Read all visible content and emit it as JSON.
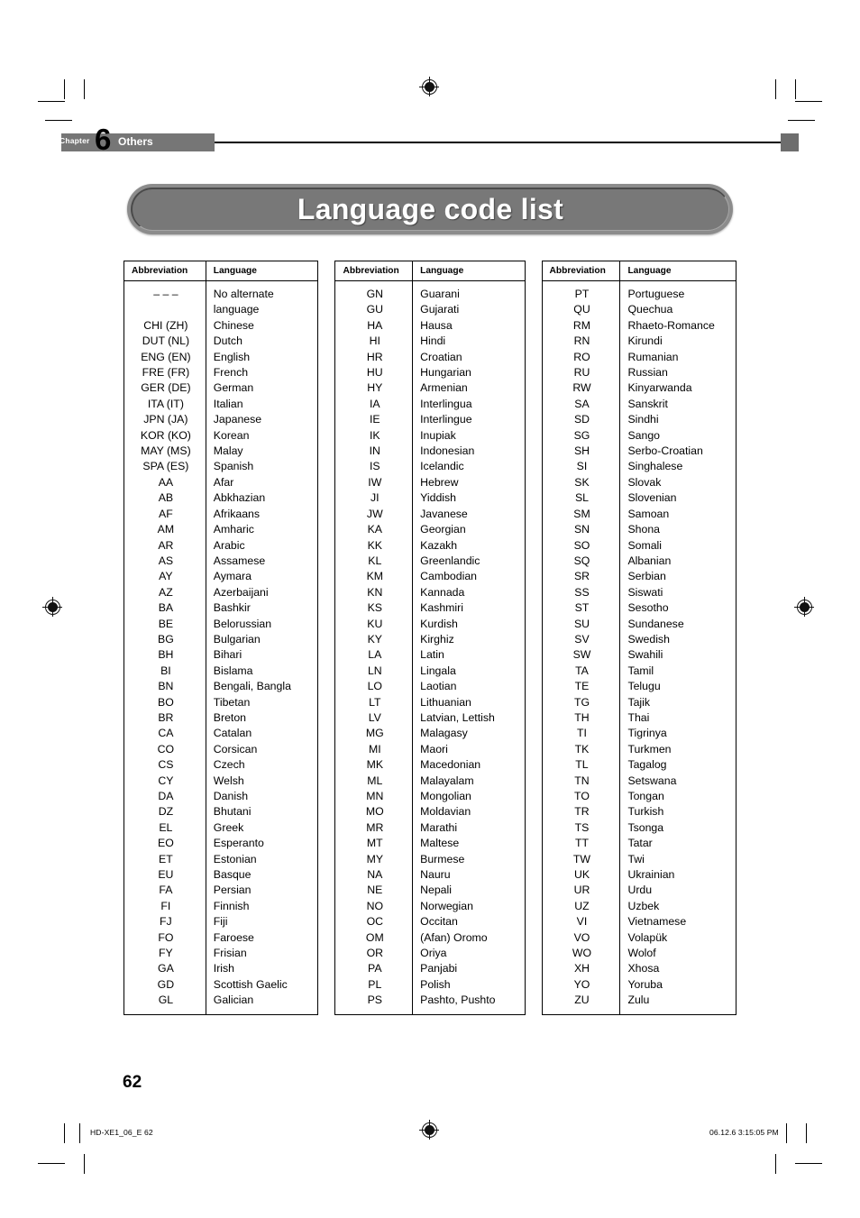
{
  "header": {
    "chapter_word": "Chapter",
    "chapter_number": "6",
    "chapter_title": "Others"
  },
  "title": "Language code list",
  "table_headers": {
    "abbreviation": "Abbreviation",
    "language": "Language"
  },
  "columns": [
    {
      "rows": [
        {
          "abbr": "– – –",
          "lang": "No alternate"
        },
        {
          "abbr": "",
          "lang": "language"
        },
        {
          "abbr": "CHI (ZH)",
          "lang": "Chinese"
        },
        {
          "abbr": "DUT (NL)",
          "lang": "Dutch"
        },
        {
          "abbr": "ENG (EN)",
          "lang": "English"
        },
        {
          "abbr": "FRE (FR)",
          "lang": "French"
        },
        {
          "abbr": "GER (DE)",
          "lang": "German"
        },
        {
          "abbr": "ITA (IT)",
          "lang": "Italian"
        },
        {
          "abbr": "JPN (JA)",
          "lang": "Japanese"
        },
        {
          "abbr": "KOR (KO)",
          "lang": "Korean"
        },
        {
          "abbr": "MAY (MS)",
          "lang": "Malay"
        },
        {
          "abbr": "SPA (ES)",
          "lang": "Spanish"
        },
        {
          "abbr": "AA",
          "lang": "Afar"
        },
        {
          "abbr": "AB",
          "lang": "Abkhazian"
        },
        {
          "abbr": "AF",
          "lang": "Afrikaans"
        },
        {
          "abbr": "AM",
          "lang": "Amharic"
        },
        {
          "abbr": "AR",
          "lang": "Arabic"
        },
        {
          "abbr": "AS",
          "lang": "Assamese"
        },
        {
          "abbr": "AY",
          "lang": "Aymara"
        },
        {
          "abbr": "AZ",
          "lang": "Azerbaijani"
        },
        {
          "abbr": "BA",
          "lang": "Bashkir"
        },
        {
          "abbr": "BE",
          "lang": "Belorussian"
        },
        {
          "abbr": "BG",
          "lang": "Bulgarian"
        },
        {
          "abbr": "BH",
          "lang": "Bihari"
        },
        {
          "abbr": "BI",
          "lang": "Bislama"
        },
        {
          "abbr": "BN",
          "lang": "Bengali, Bangla"
        },
        {
          "abbr": "BO",
          "lang": "Tibetan"
        },
        {
          "abbr": "BR",
          "lang": "Breton"
        },
        {
          "abbr": "CA",
          "lang": "Catalan"
        },
        {
          "abbr": "CO",
          "lang": "Corsican"
        },
        {
          "abbr": "CS",
          "lang": "Czech"
        },
        {
          "abbr": "CY",
          "lang": "Welsh"
        },
        {
          "abbr": "DA",
          "lang": "Danish"
        },
        {
          "abbr": "DZ",
          "lang": "Bhutani"
        },
        {
          "abbr": "EL",
          "lang": "Greek"
        },
        {
          "abbr": "EO",
          "lang": "Esperanto"
        },
        {
          "abbr": "ET",
          "lang": "Estonian"
        },
        {
          "abbr": "EU",
          "lang": "Basque"
        },
        {
          "abbr": "FA",
          "lang": "Persian"
        },
        {
          "abbr": "FI",
          "lang": "Finnish"
        },
        {
          "abbr": "FJ",
          "lang": "Fiji"
        },
        {
          "abbr": "FO",
          "lang": "Faroese"
        },
        {
          "abbr": "FY",
          "lang": "Frisian"
        },
        {
          "abbr": "GA",
          "lang": "Irish"
        },
        {
          "abbr": "GD",
          "lang": "Scottish Gaelic"
        },
        {
          "abbr": "GL",
          "lang": "Galician"
        }
      ]
    },
    {
      "rows": [
        {
          "abbr": "GN",
          "lang": "Guarani"
        },
        {
          "abbr": "GU",
          "lang": "Gujarati"
        },
        {
          "abbr": "HA",
          "lang": "Hausa"
        },
        {
          "abbr": "HI",
          "lang": "Hindi"
        },
        {
          "abbr": "HR",
          "lang": "Croatian"
        },
        {
          "abbr": "HU",
          "lang": "Hungarian"
        },
        {
          "abbr": "HY",
          "lang": "Armenian"
        },
        {
          "abbr": "IA",
          "lang": "Interlingua"
        },
        {
          "abbr": "IE",
          "lang": "Interlingue"
        },
        {
          "abbr": "IK",
          "lang": "Inupiak"
        },
        {
          "abbr": "IN",
          "lang": "Indonesian"
        },
        {
          "abbr": "IS",
          "lang": "Icelandic"
        },
        {
          "abbr": "IW",
          "lang": "Hebrew"
        },
        {
          "abbr": "JI",
          "lang": "Yiddish"
        },
        {
          "abbr": "JW",
          "lang": "Javanese"
        },
        {
          "abbr": "KA",
          "lang": "Georgian"
        },
        {
          "abbr": "KK",
          "lang": "Kazakh"
        },
        {
          "abbr": "KL",
          "lang": "Greenlandic"
        },
        {
          "abbr": "KM",
          "lang": "Cambodian"
        },
        {
          "abbr": "KN",
          "lang": "Kannada"
        },
        {
          "abbr": "KS",
          "lang": "Kashmiri"
        },
        {
          "abbr": "KU",
          "lang": "Kurdish"
        },
        {
          "abbr": "KY",
          "lang": "Kirghiz"
        },
        {
          "abbr": "LA",
          "lang": "Latin"
        },
        {
          "abbr": "LN",
          "lang": "Lingala"
        },
        {
          "abbr": "LO",
          "lang": "Laotian"
        },
        {
          "abbr": "LT",
          "lang": "Lithuanian"
        },
        {
          "abbr": "LV",
          "lang": "Latvian, Lettish"
        },
        {
          "abbr": "MG",
          "lang": "Malagasy"
        },
        {
          "abbr": "MI",
          "lang": "Maori"
        },
        {
          "abbr": "MK",
          "lang": "Macedonian"
        },
        {
          "abbr": "ML",
          "lang": "Malayalam"
        },
        {
          "abbr": "MN",
          "lang": "Mongolian"
        },
        {
          "abbr": "MO",
          "lang": "Moldavian"
        },
        {
          "abbr": "MR",
          "lang": "Marathi"
        },
        {
          "abbr": "MT",
          "lang": "Maltese"
        },
        {
          "abbr": "MY",
          "lang": "Burmese"
        },
        {
          "abbr": "NA",
          "lang": "Nauru"
        },
        {
          "abbr": "NE",
          "lang": "Nepali"
        },
        {
          "abbr": "NO",
          "lang": "Norwegian"
        },
        {
          "abbr": "OC",
          "lang": "Occitan"
        },
        {
          "abbr": "OM",
          "lang": "(Afan) Oromo"
        },
        {
          "abbr": "OR",
          "lang": "Oriya"
        },
        {
          "abbr": "PA",
          "lang": "Panjabi"
        },
        {
          "abbr": "PL",
          "lang": "Polish"
        },
        {
          "abbr": "PS",
          "lang": "Pashto, Pushto"
        }
      ]
    },
    {
      "rows": [
        {
          "abbr": "PT",
          "lang": "Portuguese"
        },
        {
          "abbr": "QU",
          "lang": "Quechua"
        },
        {
          "abbr": "RM",
          "lang": "Rhaeto-Romance"
        },
        {
          "abbr": "RN",
          "lang": "Kirundi"
        },
        {
          "abbr": "RO",
          "lang": "Rumanian"
        },
        {
          "abbr": "RU",
          "lang": "Russian"
        },
        {
          "abbr": "RW",
          "lang": "Kinyarwanda"
        },
        {
          "abbr": "SA",
          "lang": "Sanskrit"
        },
        {
          "abbr": "SD",
          "lang": "Sindhi"
        },
        {
          "abbr": "SG",
          "lang": "Sango"
        },
        {
          "abbr": "SH",
          "lang": "Serbo-Croatian"
        },
        {
          "abbr": "SI",
          "lang": "Singhalese"
        },
        {
          "abbr": "SK",
          "lang": "Slovak"
        },
        {
          "abbr": "SL",
          "lang": "Slovenian"
        },
        {
          "abbr": "SM",
          "lang": "Samoan"
        },
        {
          "abbr": "SN",
          "lang": "Shona"
        },
        {
          "abbr": "SO",
          "lang": "Somali"
        },
        {
          "abbr": "SQ",
          "lang": "Albanian"
        },
        {
          "abbr": "SR",
          "lang": "Serbian"
        },
        {
          "abbr": "SS",
          "lang": "Siswati"
        },
        {
          "abbr": "ST",
          "lang": "Sesotho"
        },
        {
          "abbr": "SU",
          "lang": "Sundanese"
        },
        {
          "abbr": "SV",
          "lang": "Swedish"
        },
        {
          "abbr": "SW",
          "lang": "Swahili"
        },
        {
          "abbr": "TA",
          "lang": "Tamil"
        },
        {
          "abbr": "TE",
          "lang": "Telugu"
        },
        {
          "abbr": "TG",
          "lang": "Tajik"
        },
        {
          "abbr": "TH",
          "lang": "Thai"
        },
        {
          "abbr": "TI",
          "lang": "Tigrinya"
        },
        {
          "abbr": "TK",
          "lang": "Turkmen"
        },
        {
          "abbr": "TL",
          "lang": "Tagalog"
        },
        {
          "abbr": "TN",
          "lang": "Setswana"
        },
        {
          "abbr": "TO",
          "lang": "Tongan"
        },
        {
          "abbr": "TR",
          "lang": "Turkish"
        },
        {
          "abbr": "TS",
          "lang": "Tsonga"
        },
        {
          "abbr": "TT",
          "lang": "Tatar"
        },
        {
          "abbr": "TW",
          "lang": "Twi"
        },
        {
          "abbr": "UK",
          "lang": "Ukrainian"
        },
        {
          "abbr": "UR",
          "lang": "Urdu"
        },
        {
          "abbr": "UZ",
          "lang": "Uzbek"
        },
        {
          "abbr": "VI",
          "lang": "Vietnamese"
        },
        {
          "abbr": "VO",
          "lang": "Volapük"
        },
        {
          "abbr": "WO",
          "lang": "Wolof"
        },
        {
          "abbr": "XH",
          "lang": "Xhosa"
        },
        {
          "abbr": "YO",
          "lang": "Yoruba"
        },
        {
          "abbr": "ZU",
          "lang": "Zulu"
        }
      ]
    }
  ],
  "page_number": "62",
  "footer": {
    "left": "HD-XE1_06_E   62",
    "right": "06.12.6   3:15:05 PM"
  },
  "colors": {
    "chapter_bar": "#767676",
    "title_pill": "#787878",
    "text": "#000000"
  }
}
